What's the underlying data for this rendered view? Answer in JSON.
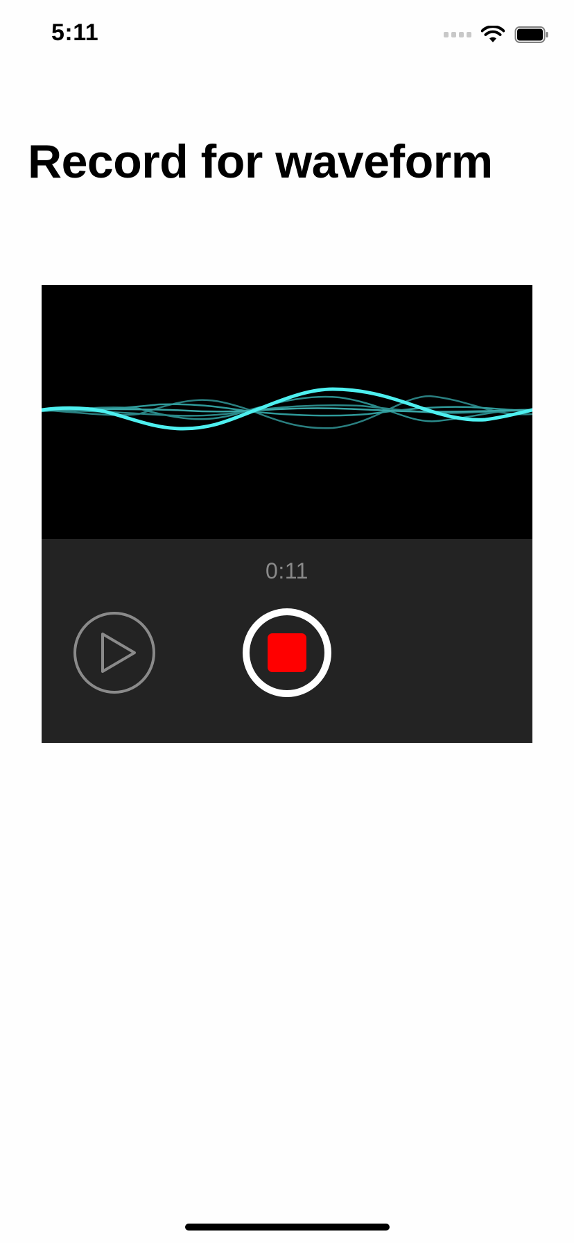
{
  "status_bar": {
    "time": "5:11",
    "icons": [
      "cellular-signal-icon",
      "wifi-icon",
      "battery-icon"
    ]
  },
  "page": {
    "title": "Record for waveform"
  },
  "recorder": {
    "elapsed_time": "0:11",
    "state": "recording",
    "controls": {
      "play_icon": "play-icon",
      "stop_icon": "stop-icon"
    },
    "colors": {
      "waveform_primary": "#4ef0f0",
      "waveform_secondary": "#2a8a8a",
      "waveform_background": "#000000",
      "controls_background": "#232323",
      "stop_square": "#ff0000",
      "play_outline": "#8a8a8a"
    }
  }
}
